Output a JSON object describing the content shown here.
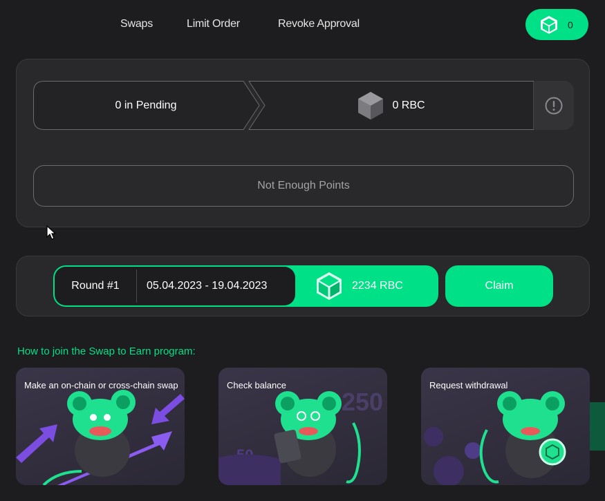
{
  "nav": {
    "items": [
      "Swaps",
      "Limit Order",
      "Revoke Approval"
    ],
    "wallet_count": "0"
  },
  "points": {
    "pending": "0 in Pending",
    "rbc": "0 RBC",
    "not_enough": "Not Enough Points"
  },
  "round": {
    "label": "Round #1",
    "dates": "05.04.2023 - 19.04.2023",
    "amount": "2234 RBC",
    "claim": "Claim"
  },
  "howto": {
    "title": "How to join the Swap to Earn program:",
    "steps": [
      "Make an on-chain or cross-chain swap",
      "Check balance",
      "Request withdrawal"
    ],
    "card2_numbers": [
      "250",
      "50"
    ]
  },
  "colors": {
    "accent": "#00e086",
    "background": "#1d1d1f",
    "panel": "#29292b",
    "card": "#3a3548",
    "purple": "#7b4de0"
  },
  "icons": [
    "rbc-cube-icon",
    "info-icon",
    "mouse-cursor-icon"
  ]
}
